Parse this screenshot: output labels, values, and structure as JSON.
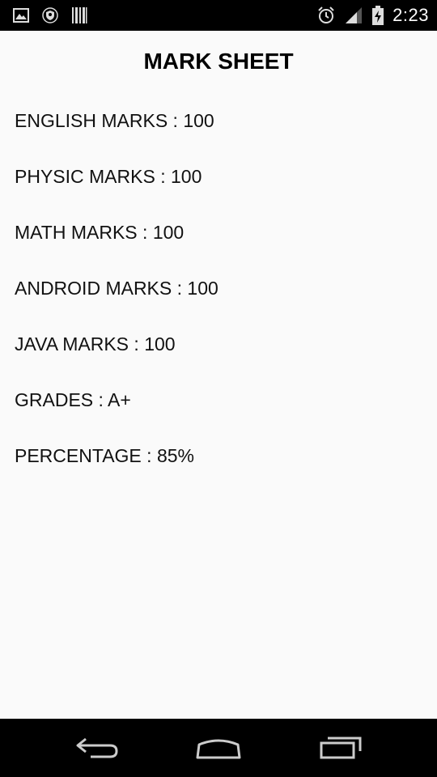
{
  "status_bar": {
    "time": "2:23",
    "icons_left": [
      "image-notification-icon",
      "shield-notification-icon",
      "barcode-notification-icon"
    ],
    "icons_right": [
      "alarm-icon",
      "signal-icon",
      "battery-charging-icon"
    ]
  },
  "page": {
    "title": "MARK SHEET",
    "rows": [
      {
        "label": "ENGLISH MARKS",
        "separator": " : ",
        "value": "100"
      },
      {
        "label": "PHYSIC MARKS",
        "separator": " : ",
        "value": "100"
      },
      {
        "label": "MATH MARKS",
        "separator": " : ",
        "value": "100"
      },
      {
        "label": "ANDROID MARKS",
        "separator": " : ",
        "value": "100"
      },
      {
        "label": "JAVA MARKS",
        "separator": " : ",
        "value": "100"
      },
      {
        "label": "GRADES",
        "separator": " : ",
        "value": "A+"
      },
      {
        "label": "PERCENTAGE",
        "separator": " : ",
        "value": "85%"
      }
    ]
  },
  "nav_bar": {
    "buttons": [
      "back-button",
      "home-button",
      "recents-button"
    ]
  },
  "colors": {
    "status_bar_bg": "#000000",
    "content_bg": "#fafafa",
    "text": "#111111",
    "nav_bar_bg": "#000000"
  }
}
